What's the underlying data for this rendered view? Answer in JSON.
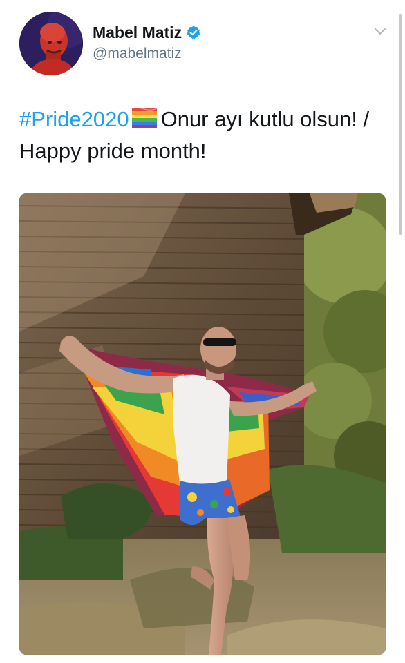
{
  "tweet": {
    "author": {
      "display_name": "Mabel Matiz",
      "handle": "@mabelmatiz",
      "verified": true,
      "avatar_icon": "profile-photo"
    },
    "menu_icon": "chevron-down-icon",
    "text": {
      "hashtag": "#Pride2020",
      "emoji": "rainbow-flag-icon",
      "body": "Onur ayı kutlu olsun! / Happy pride month!"
    },
    "media": {
      "type": "photo",
      "subject": "man holding rainbow pride flag in front of wooden wall"
    }
  },
  "colors": {
    "link": "#1da1f2",
    "verified_badge": "#1da1f2",
    "secondary_text": "#657786",
    "primary_text": "#14171a"
  }
}
